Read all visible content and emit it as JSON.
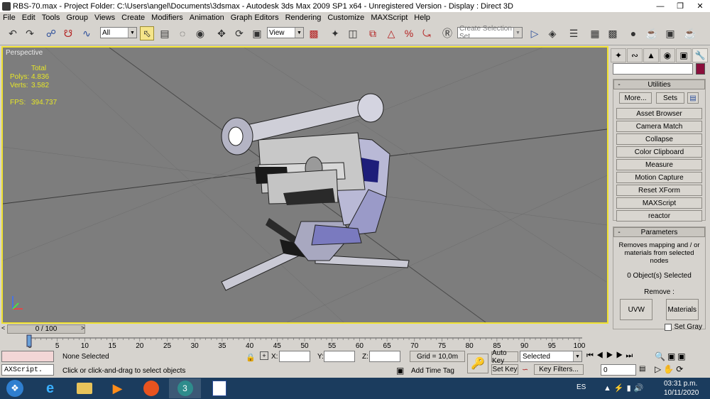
{
  "window": {
    "title": "RBS-70.max    - Project Folder: C:\\Users\\angel\\Documents\\3dsmax    - Autodesk 3ds Max  2009 SP1  x64    - Unregistered Version    - Display : Direct 3D"
  },
  "menu": [
    "File",
    "Edit",
    "Tools",
    "Group",
    "Views",
    "Create",
    "Modifiers",
    "Animation",
    "Graph Editors",
    "Rendering",
    "Customize",
    "MAXScript",
    "Help"
  ],
  "toolbar": {
    "filter_value": "All",
    "coord_value": "View",
    "named_selection_placeholder": "Create Selection Set"
  },
  "viewport": {
    "label": "Perspective",
    "stats_header": "Total",
    "polys_label": "Polys:",
    "polys_value": "4.836",
    "verts_label": "Verts:",
    "verts_value": "3.582",
    "fps_label": "FPS:",
    "fps_value": "394.737"
  },
  "command_panel": {
    "utilities_title": "Utilities",
    "more_label": "More...",
    "sets_label": "Sets",
    "utilities": [
      "Asset Browser",
      "Camera Match",
      "Collapse",
      "Color Clipboard",
      "Measure",
      "Motion Capture",
      "Reset XForm",
      "MAXScript",
      "reactor"
    ],
    "parameters_title": "Parameters",
    "description": "Removes mapping and / or materials from selected nodes",
    "selected_count": "0 Object(s) Selected",
    "remove_label": "Remove :",
    "uvw_label": "UVW",
    "materials_label": "Materials",
    "set_gray_label": "Set Gray",
    "color_swatch": "#8a0f3c"
  },
  "timeline": {
    "slider_label": "0 / 100",
    "ticks": [
      "0",
      "5",
      "10",
      "15",
      "20",
      "25",
      "30",
      "35",
      "40",
      "45",
      "50",
      "55",
      "60",
      "65",
      "70",
      "75",
      "80",
      "85",
      "90",
      "95",
      "100"
    ]
  },
  "status": {
    "maxscript_label": "AXScript.",
    "selection_status": "None Selected",
    "prompt": "Click or click-and-drag to select objects",
    "x_label": "X:",
    "y_label": "Y:",
    "z_label": "Z:",
    "grid_label": "Grid = 10,0m",
    "add_time_tag": "Add Time Tag",
    "auto_key": "Auto Key",
    "set_key": "Set Key",
    "selected_dropdown": "Selected",
    "key_filters": "Key Filters...",
    "frame_value": "0"
  },
  "taskbar": {
    "lang": "ES",
    "time": "03:31 p.m.",
    "date": "10/11/2020"
  }
}
